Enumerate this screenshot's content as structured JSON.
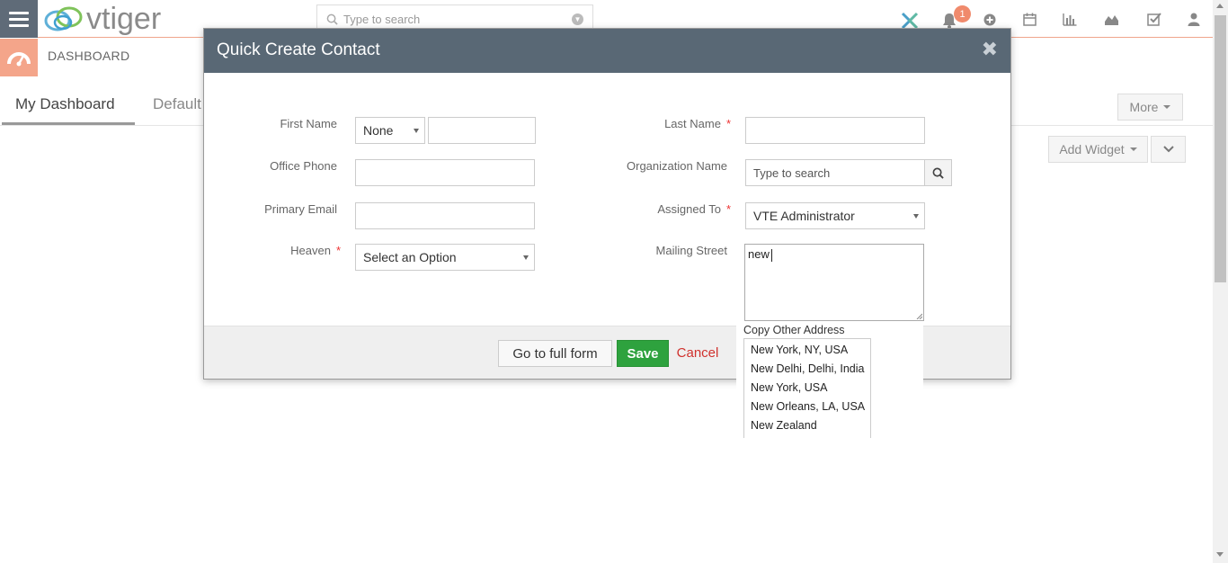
{
  "app": {
    "logo_text": "vtiger",
    "search_placeholder": "Type to search",
    "notification_count": "1",
    "module_label": "DASHBOARD"
  },
  "tabs": [
    {
      "label": "My Dashboard"
    },
    {
      "label": "Default"
    }
  ],
  "toolbar": {
    "more_label": "More",
    "add_widget_label": "Add Widget"
  },
  "modal": {
    "title": "Quick Create Contact",
    "fields": {
      "first_name": {
        "label": "First Name",
        "salutation": "None",
        "value": ""
      },
      "last_name": {
        "label": "Last Name",
        "required": "*",
        "value": ""
      },
      "office_phone": {
        "label": "Office Phone",
        "value": ""
      },
      "organization_name": {
        "label": "Organization Name",
        "placeholder": "Type to search"
      },
      "primary_email": {
        "label": "Primary Email",
        "value": ""
      },
      "assigned_to": {
        "label": "Assigned To",
        "required": "*",
        "value": "VTE Administrator"
      },
      "heaven": {
        "label": "Heaven",
        "required": "*",
        "value": "Select an Option"
      },
      "mailing_street": {
        "label": "Mailing Street",
        "value": "new"
      }
    },
    "buttons": {
      "full_form": "Go to full form",
      "save": "Save",
      "cancel": "Cancel"
    }
  },
  "autocomplete": {
    "copy_label": "Copy Other Address",
    "items": [
      "New York, NY, USA",
      "New Delhi, Delhi, India",
      "New York, USA",
      "New Orleans, LA, USA",
      "New Zealand"
    ]
  },
  "colors": {
    "modal_header": "#596875",
    "save_green": "#2ea23e",
    "cancel_red": "#d0312d",
    "accent_orange": "#f4a58a"
  }
}
